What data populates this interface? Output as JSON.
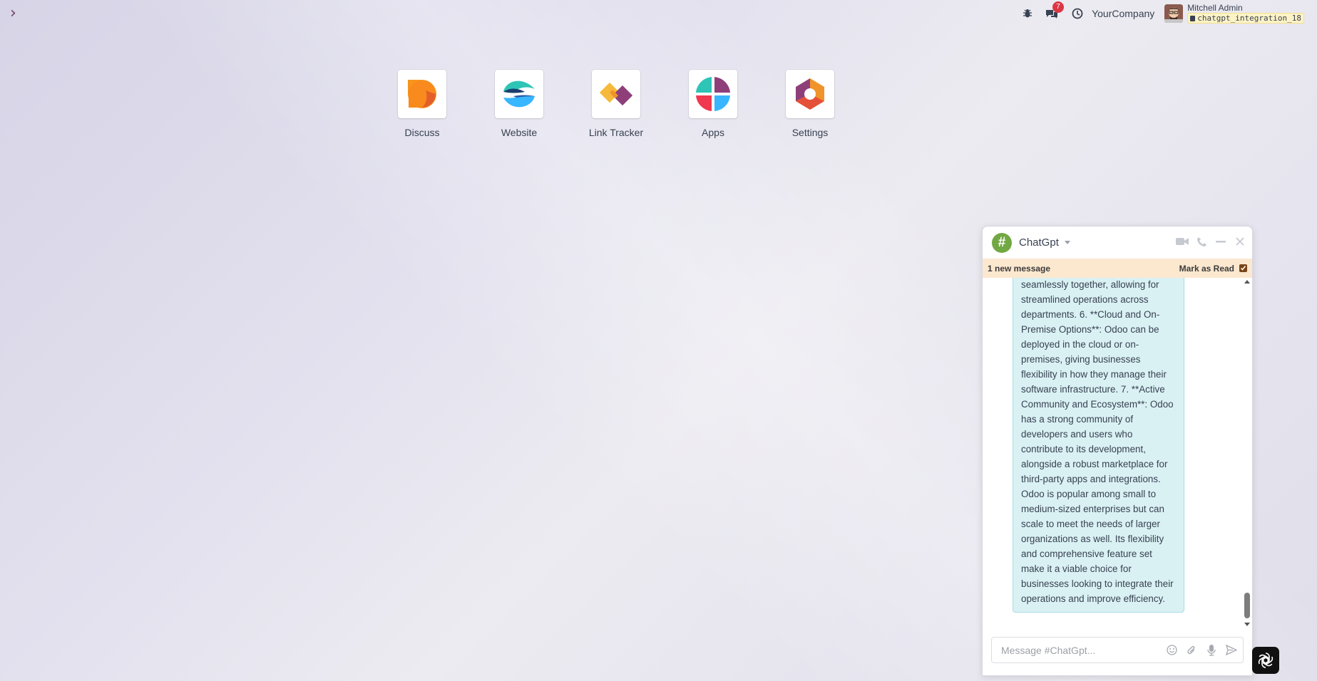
{
  "topbar": {
    "menu_toggle_glyph": "›",
    "messages_badge": "7",
    "company": "YourCompany",
    "user_name": "Mitchell Admin",
    "database": "chatgpt_integration_18"
  },
  "apps": [
    {
      "label": "Discuss",
      "icon": "discuss-icon"
    },
    {
      "label": "Website",
      "icon": "website-icon"
    },
    {
      "label": "Link Tracker",
      "icon": "link-tracker-icon"
    },
    {
      "label": "Apps",
      "icon": "apps-icon"
    },
    {
      "label": "Settings",
      "icon": "settings-icon"
    }
  ],
  "chat": {
    "channel_glyph": "#",
    "title": "ChatGpt",
    "new_message_text": "1 new message",
    "mark_as_read": "Mark as Read",
    "message_text": "seamlessly together, allowing for streamlined operations across departments. 6. **Cloud and On-Premise Options**: Odoo can be deployed in the cloud or on-premises, giving businesses flexibility in how they manage their software infrastructure. 7. **Active Community and Ecosystem**: Odoo has a strong community of developers and users who contribute to its development, alongside a robust marketplace for third-party apps and integrations. Odoo is popular among small to medium-sized enterprises but can scale to meet the needs of larger organizations as well. Its flexibility and comprehensive feature set make it a viable choice for businesses looking to integrate their operations and improve efficiency.",
    "composer_placeholder": "Message #ChatGpt..."
  },
  "colors": {
    "brand": "#714B67",
    "badge": "#dc3545",
    "channel_avatar": "#72a843",
    "bubble_bg": "#daf1f4",
    "new_message_bar": "#fbe8cf"
  }
}
